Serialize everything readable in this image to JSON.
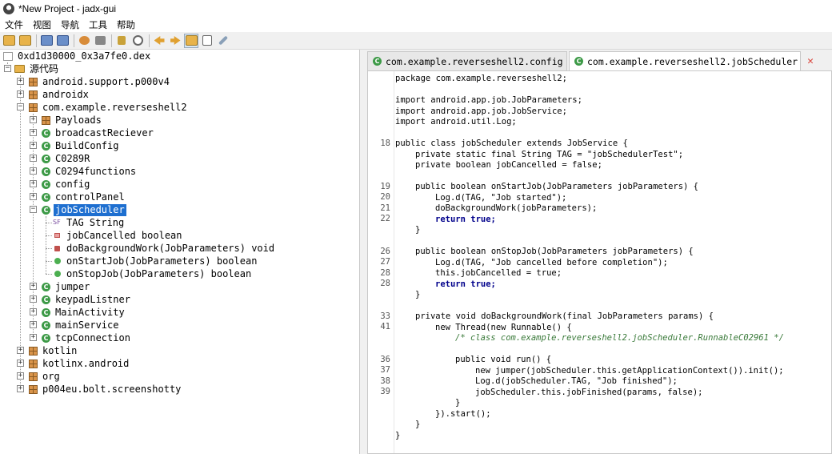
{
  "window": {
    "title": "*New Project - jadx-gui"
  },
  "menu": [
    "文件",
    "视图",
    "导航",
    "工具",
    "帮助"
  ],
  "toolbar": {
    "icons": [
      "open-icon",
      "save-icon",
      "copy-icon",
      "paste-icon",
      "sync-icon",
      "deobfuscate-icon",
      "search-icon",
      "find-class-icon",
      "back-icon",
      "forward-icon",
      "flatten-icon",
      "log-icon",
      "preferences-icon"
    ],
    "active_index": 10
  },
  "tree": {
    "root": "0xd1d30000_0x3a7fe0.dex",
    "source_folder": "源代码",
    "packages_top": [
      "android.support.p000v4",
      "androidx",
      "com.example.reverseshell2"
    ],
    "children": [
      "Payloads",
      "broadcastReciever",
      "BuildConfig",
      "C0289R",
      "C0294functions",
      "config",
      "controlPanel",
      "jobScheduler"
    ],
    "members": [
      "TAG String",
      "jobCancelled boolean",
      "doBackgroundWork(JobParameters) void",
      "onStartJob(JobParameters) boolean",
      "onStopJob(JobParameters) boolean"
    ],
    "children_after": [
      "jumper",
      "keypadListner",
      "MainActivity",
      "mainService",
      "tcpConnection"
    ],
    "packages_bottom": [
      "kotlin",
      "kotlinx.android",
      "org",
      "p004eu.bolt.screenshotty"
    ],
    "selected": "jobScheduler"
  },
  "tabs": [
    {
      "label": "com.example.reverseshell2.config",
      "active": false
    },
    {
      "label": "com.example.reverseshell2.jobScheduler",
      "active": true
    }
  ],
  "code": {
    "line_numbers": [
      "18",
      "19",
      "20",
      "21",
      "22",
      "26",
      "27",
      "28",
      "28",
      "33",
      "41",
      "36",
      "37",
      "38",
      "39"
    ],
    "lines": [
      "package com.example.reverseshell2;",
      "import android.app.job.JobParameters;",
      "import android.app.job.JobService;",
      "import android.util.Log;",
      "public class jobScheduler extends JobService {",
      "private static final String TAG = \"jobSchedulerTest\";",
      "private boolean jobCancelled = false;",
      "public boolean onStartJob(JobParameters jobParameters) {",
      "Log.d(TAG, \"Job started\");",
      "doBackgroundWork(jobParameters);",
      "return true;",
      "}",
      "public boolean onStopJob(JobParameters jobParameters) {",
      "Log.d(TAG, \"Job cancelled before completion\");",
      "this.jobCancelled = true;",
      "return true;",
      "}",
      "private void doBackgroundWork(final JobParameters params) {",
      "new Thread(new Runnable() {",
      "/* class com.example.reverseshell2.jobScheduler.RunnableC02961 */",
      "public void run() {",
      "new jumper(jobScheduler.this.getApplicationContext()).init();",
      "Log.d(jobScheduler.TAG, \"Job finished\");",
      "jobScheduler.this.jobFinished(params, false);",
      "}",
      "}).start();",
      "}",
      "}"
    ]
  }
}
